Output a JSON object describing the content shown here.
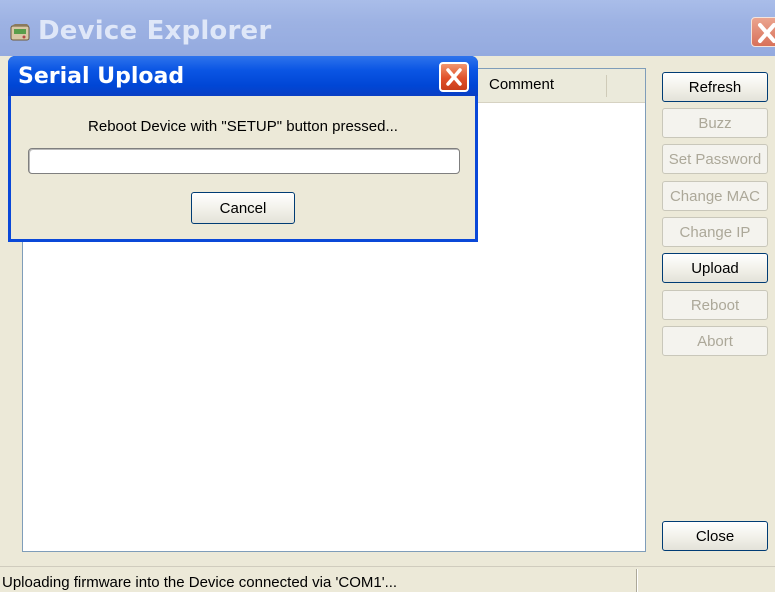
{
  "main_window": {
    "title": "Device Explorer",
    "icon": "device-explorer-app-icon",
    "close_icon": "close-icon"
  },
  "device_list": {
    "columns": [
      "Comment"
    ],
    "rows": []
  },
  "buttons": [
    {
      "label": "Refresh",
      "enabled": true
    },
    {
      "label": "Buzz",
      "enabled": false
    },
    {
      "label": "Set Password",
      "enabled": false
    },
    {
      "label": "Change MAC",
      "enabled": false
    },
    {
      "label": "Change IP",
      "enabled": false
    },
    {
      "label": "Upload",
      "enabled": true
    },
    {
      "label": "Reboot",
      "enabled": false
    },
    {
      "label": "Abort",
      "enabled": false
    }
  ],
  "close_button": {
    "label": "Close"
  },
  "status_bar": {
    "text": "Uploading firmware into the Device connected via 'COM1'...",
    "secondary_text": ""
  },
  "dialog": {
    "title": "Serial Upload",
    "message": "Reboot Device with \"SETUP\" button pressed...",
    "progress": 0,
    "cancel_label": "Cancel",
    "close_icon": "close-icon"
  },
  "colors": {
    "active_titlebar": "#0046d5",
    "inactive_titlebar": "#9db2e3",
    "window_face": "#ece9d8",
    "close_button": "#e0502a"
  }
}
